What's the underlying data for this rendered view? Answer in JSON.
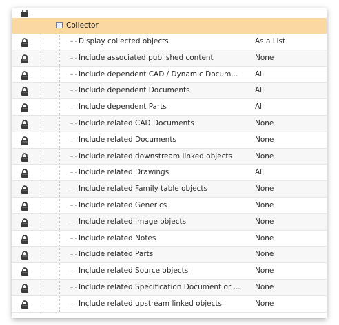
{
  "group": {
    "title": "Collector"
  },
  "rows": [
    {
      "label": "Display collected objects",
      "value": "As a List"
    },
    {
      "label": "Include associated published content",
      "value": "None"
    },
    {
      "label": "Include dependent CAD / Dynamic Docum...",
      "value": "All"
    },
    {
      "label": "Include dependent Documents",
      "value": "All"
    },
    {
      "label": "Include dependent Parts",
      "value": "All"
    },
    {
      "label": "Include related CAD Documents",
      "value": "None"
    },
    {
      "label": "Include related Documents",
      "value": "None"
    },
    {
      "label": "Include related downstream linked objects",
      "value": "None"
    },
    {
      "label": "Include related Drawings",
      "value": "All"
    },
    {
      "label": "Include related Family table objects",
      "value": "None"
    },
    {
      "label": "Include related Generics",
      "value": "None"
    },
    {
      "label": "Include related Image objects",
      "value": "None"
    },
    {
      "label": "Include related Notes",
      "value": "None"
    },
    {
      "label": "Include related Parts",
      "value": "None"
    },
    {
      "label": "Include related Source objects",
      "value": "None"
    },
    {
      "label": "Include related Specification Document or ...",
      "value": "None"
    },
    {
      "label": "Include related upstream linked objects",
      "value": "None"
    }
  ],
  "colors": {
    "header_bg": "#fbd7a2",
    "lock": "#3a3a3a"
  },
  "icons": {
    "row_icon": "lock-icon",
    "group_toggle": "collapse-minus-icon"
  }
}
